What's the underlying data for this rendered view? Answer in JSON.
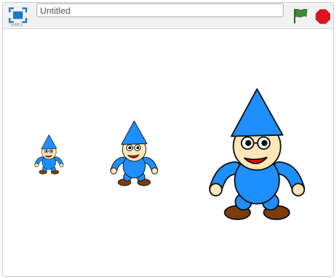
{
  "player": {
    "version": "v461",
    "title_value": "Untitled",
    "buttons": {
      "fullscreen_icon": "fullscreen-icon",
      "green_flag_icon": "green-flag-icon",
      "stop_icon": "stop-sign-icon"
    }
  },
  "stage": {
    "sprites": [
      {
        "name": "gnome-small",
        "scale_level": "small"
      },
      {
        "name": "gnome-medium",
        "scale_level": "medium"
      },
      {
        "name": "gnome-large",
        "scale_level": "large"
      }
    ]
  },
  "colors": {
    "hat": "#1e8fff",
    "body": "#1e8fff",
    "skin": "#fde6b8",
    "shoe": "#7a3d0a",
    "mouth": "#e8100a",
    "flag": "#3e8a32",
    "stop": "#e0141e",
    "fullscreen": "#1d77c9"
  }
}
